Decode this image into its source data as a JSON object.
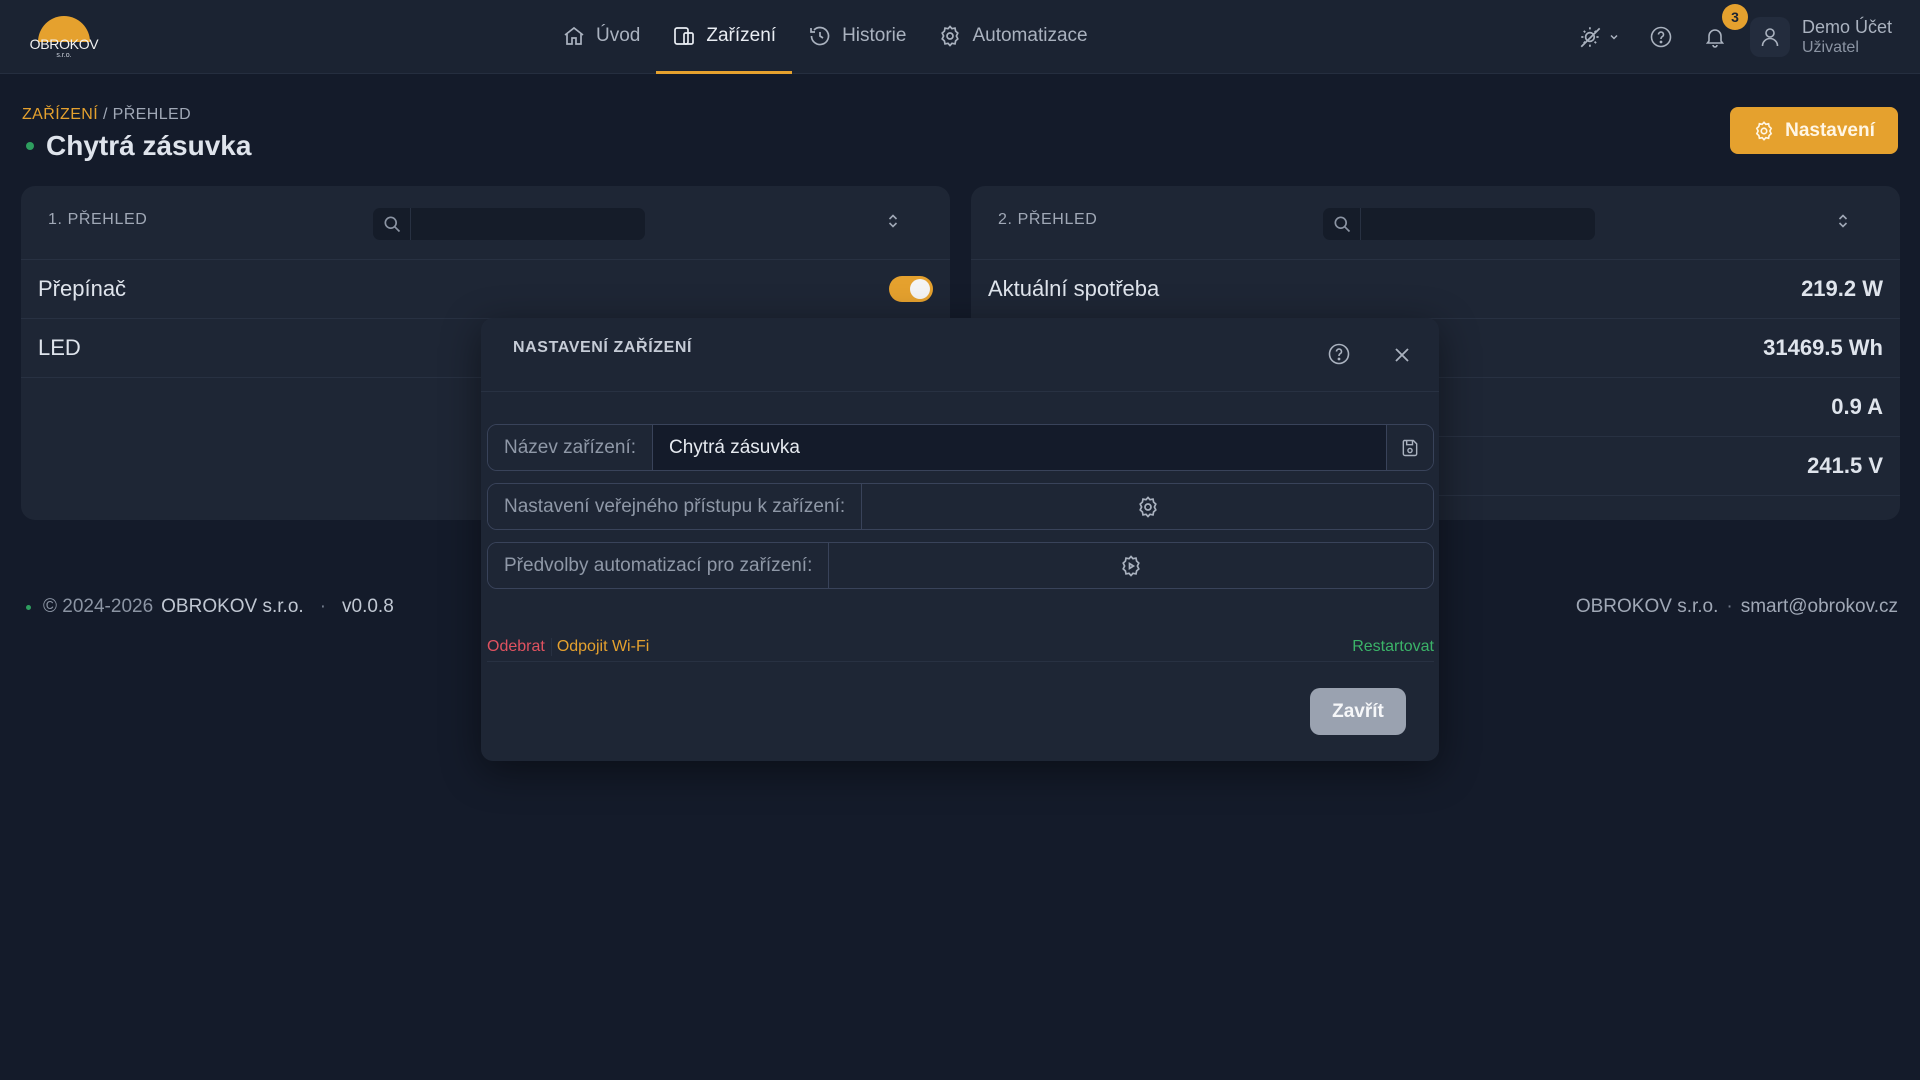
{
  "brand": {
    "logo_text": "OBROKOV",
    "logo_sub": "s.r.o.",
    "accent": "#e5a12e"
  },
  "nav": {
    "items": [
      {
        "label": "Úvod",
        "icon": "home-icon"
      },
      {
        "label": "Zařízení",
        "icon": "devices-icon",
        "active": true
      },
      {
        "label": "Historie",
        "icon": "history-icon"
      },
      {
        "label": "Automatizace",
        "icon": "gear-icon"
      }
    ]
  },
  "header": {
    "notification_count": "3",
    "user_name": "Demo Účet",
    "user_role": "Uživatel"
  },
  "page": {
    "breadcrumb_link": "ZAŘÍZENÍ",
    "breadcrumb_sep": " / ",
    "breadcrumb_current": "PŘEHLED",
    "title": "Chytrá zásuvka",
    "settings_button": "Nastavení"
  },
  "card1": {
    "title": "1. PŘEHLED",
    "search_value": "",
    "rows": [
      {
        "label": "Přepínač",
        "type": "toggle",
        "on": true
      },
      {
        "label": "LED"
      }
    ]
  },
  "card2": {
    "title": "2. PŘEHLED",
    "search_value": "",
    "rows": [
      {
        "label": "Aktuální spotřeba",
        "value": "219.2 W"
      },
      {
        "label": "",
        "value": "31469.5 Wh"
      },
      {
        "label": "",
        "value": "0.9 A"
      },
      {
        "label": "",
        "value": "241.5 V"
      }
    ]
  },
  "footer": {
    "copyright": "© 2024-2026",
    "company": "OBROKOV s.r.o.",
    "version": "v0.0.8",
    "right_company": "OBROKOV s.r.o.",
    "separator": "·",
    "email": "smart@obrokov.cz"
  },
  "modal": {
    "title": "NASTAVENÍ ZAŘÍZENÍ",
    "name_label": "Název zařízení:",
    "name_value": "Chytrá zásuvka",
    "public_access_label": "Nastavení veřejného přístupu k zařízení:",
    "automation_label": "Předvolby automatizací pro zařízení:",
    "remove": "Odebrat",
    "disconnect_wifi": "Odpojit Wi-Fi",
    "restart": "Restartovat",
    "close_button": "Zavřít"
  }
}
